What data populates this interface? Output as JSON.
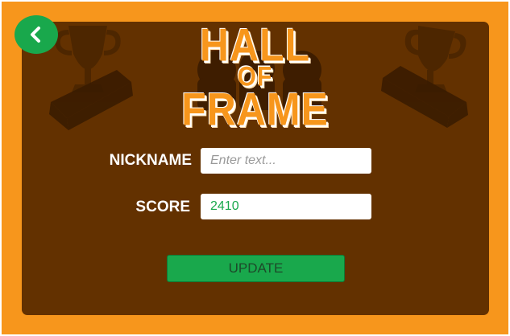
{
  "header": {
    "title_line1": "HALL",
    "title_line2": "OF",
    "title_line3": "FRAME"
  },
  "form": {
    "nickname_label": "NICKNAME",
    "nickname_placeholder": "Enter text...",
    "nickname_value": "",
    "score_label": "SCORE",
    "score_value": "2410"
  },
  "actions": {
    "update_label": "UPDATE",
    "back_icon": "chevron-left-icon"
  },
  "colors": {
    "frame": "#f7961c",
    "panel": "#633100",
    "accent": "#19a84c",
    "decor": "#4a2500"
  }
}
